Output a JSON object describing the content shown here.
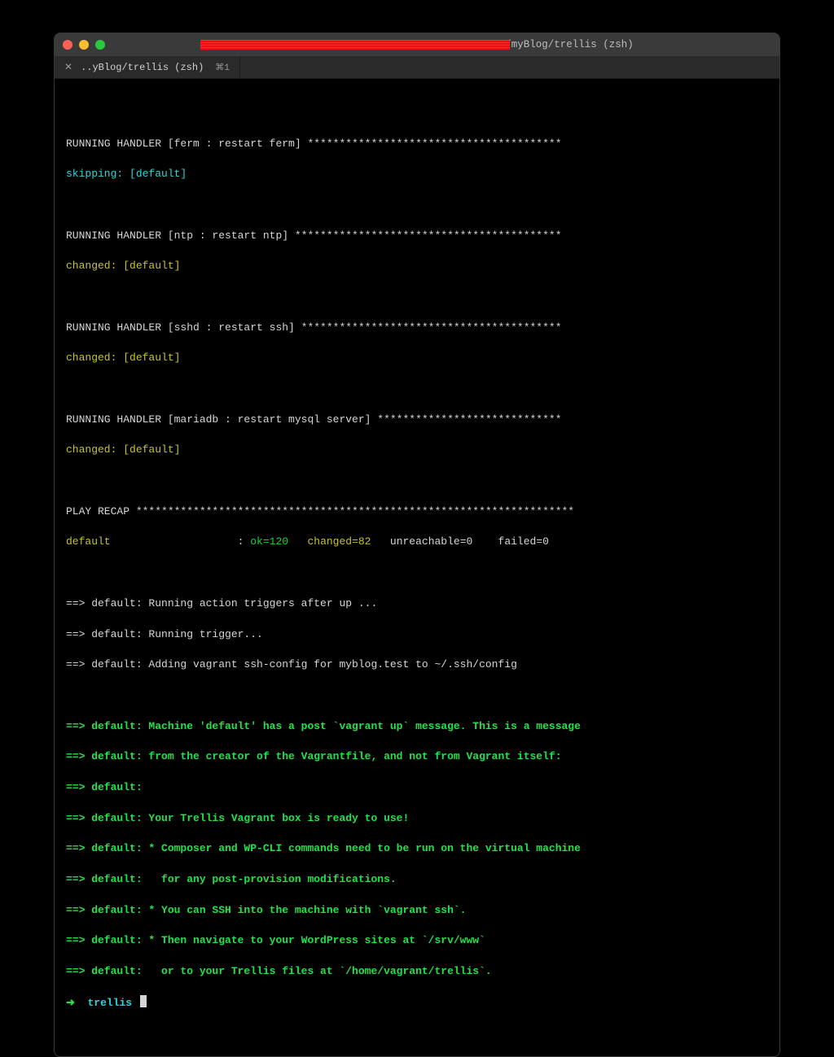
{
  "window": {
    "title_suffix": "/myBlog/trellis (zsh)"
  },
  "tab": {
    "close": "✕",
    "label": "..yBlog/trellis (zsh)",
    "shortcut": "⌘1"
  },
  "handlers": {
    "ferm": {
      "header": "RUNNING HANDLER [ferm : restart ferm] ****************************************",
      "status": "skipping: [default]"
    },
    "ntp": {
      "header": "RUNNING HANDLER [ntp : restart ntp] ******************************************",
      "status": "changed: [default]"
    },
    "sshd": {
      "header": "RUNNING HANDLER [sshd : restart ssh] *****************************************",
      "status": "changed: [default]"
    },
    "mariadb": {
      "header": "RUNNING HANDLER [mariadb : restart mysql server] *****************************",
      "status": "changed: [default]"
    }
  },
  "recap": {
    "header": "PLAY RECAP *********************************************************************",
    "host": "default",
    "sep": "                    : ",
    "ok": "ok=120",
    "changed": "changed=82",
    "unreachable": "unreachable=0",
    "failed": "failed=0"
  },
  "triggers": {
    "l1": "==> default: Running action triggers after up ...",
    "l2": "==> default: Running trigger...",
    "l3": "==> default: Adding vagrant ssh-config for myblog.test to ~/.ssh/config"
  },
  "postup": {
    "l1": "==> default: Machine 'default' has a post `vagrant up` message. This is a message",
    "l2": "==> default: from the creator of the Vagrantfile, and not from Vagrant itself:",
    "l3": "==> default:",
    "l4": "==> default: Your Trellis Vagrant box is ready to use!",
    "l5": "==> default: * Composer and WP-CLI commands need to be run on the virtual machine",
    "l6": "==> default:   for any post-provision modifications.",
    "l7": "==> default: * You can SSH into the machine with `vagrant ssh`.",
    "l8": "==> default: * Then navigate to your WordPress sites at `/srv/www`",
    "l9": "==> default:   or to your Trellis files at `/home/vagrant/trellis`."
  },
  "prompt": {
    "arrow": "➜ ",
    "dir": " trellis "
  }
}
